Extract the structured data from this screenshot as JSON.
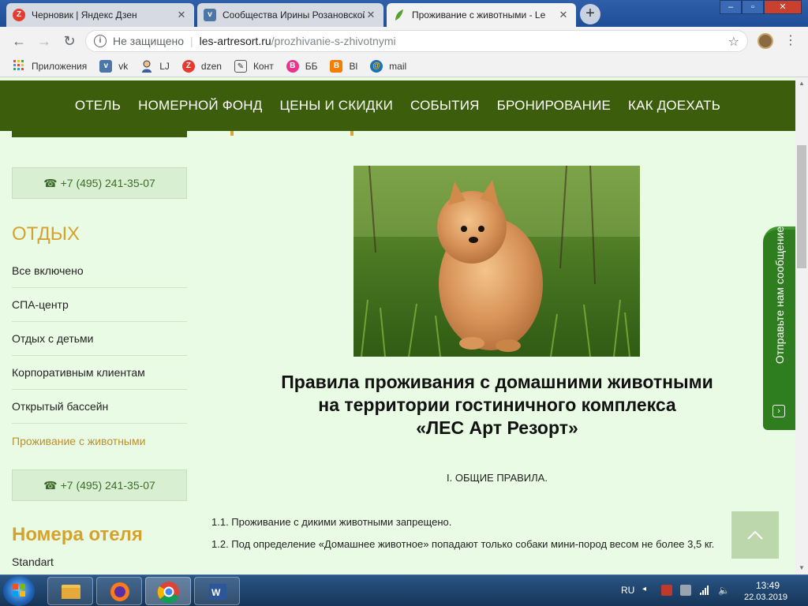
{
  "browser": {
    "tabs": [
      {
        "title": "Черновик | Яндекс Дзен",
        "icon": "yandex-zen-icon",
        "active": false
      },
      {
        "title": "Сообщества Ирины Розановской",
        "icon": "vk-icon",
        "active": false
      },
      {
        "title": "Проживание с животными - Le",
        "icon": "leaf-icon",
        "active": true
      }
    ],
    "new_tab_label": "+",
    "address": {
      "security_label": "Не защищено",
      "host": "les-artresort.ru",
      "path": "/prozhivanie-s-zhivotnymi"
    },
    "bookmarks": [
      {
        "label": "Приложения",
        "icon": "apps-grid-icon"
      },
      {
        "label": "vk",
        "icon": "vk-icon"
      },
      {
        "label": "LJ",
        "icon": "user-icon"
      },
      {
        "label": "dzen",
        "icon": "yandex-zen-icon"
      },
      {
        "label": "Конт",
        "icon": "edit-icon"
      },
      {
        "label": "ББ",
        "icon": "b-icon"
      },
      {
        "label": "Bl",
        "icon": "blogger-icon"
      },
      {
        "label": "mail",
        "icon": "mail-at-icon"
      }
    ]
  },
  "site": {
    "nav": [
      "ОТЕЛЬ",
      "НОМЕРНОЙ ФОНД",
      "ЦЕНЫ И СКИДКИ",
      "СОБЫТИЯ",
      "БРОНИРОВАНИЕ",
      "КАК ДОЕХАТЬ"
    ],
    "phone": "+7 (495) 241-35-07",
    "sidebar": {
      "rest_title": "ОТДЫХ",
      "rest_items": [
        "Все включено",
        "СПА-центр",
        "Отдых с детьми",
        "Корпоративным клиентам",
        "Открытый бассейн",
        "Проживание с животными"
      ],
      "active_index": 5,
      "rooms_title": "Номера отеля",
      "rooms_first": "Standart"
    },
    "content": {
      "title_lines": [
        "Правила проживания с домашними животными",
        "на территории гостиничного комплекса",
        "«ЛЕС Арт Резорт»"
      ],
      "section_title": "I. ОБЩИЕ ПРАВИЛА.",
      "rules": [
        "1.1. Проживание с дикими животными запрещено.",
        "1.2. Под определение «Домашнее животное» попадают только собаки мини-пород весом не более 3,5 кг."
      ],
      "image_icon": "pomeranian-puppy-photo"
    },
    "feedback_label": "Отправьте нам сообщение"
  },
  "taskbar": {
    "language": "RU",
    "time": "13:49",
    "date": "22.03.2019",
    "apps": [
      "file-explorer-icon",
      "firefox-icon",
      "chrome-icon",
      "word-icon"
    ]
  },
  "colors": {
    "nav_green": "#3c5e0c",
    "page_bg": "#eafbe5",
    "accent_gold": "#d4a22e",
    "feedback_green": "#2e7d1f"
  }
}
